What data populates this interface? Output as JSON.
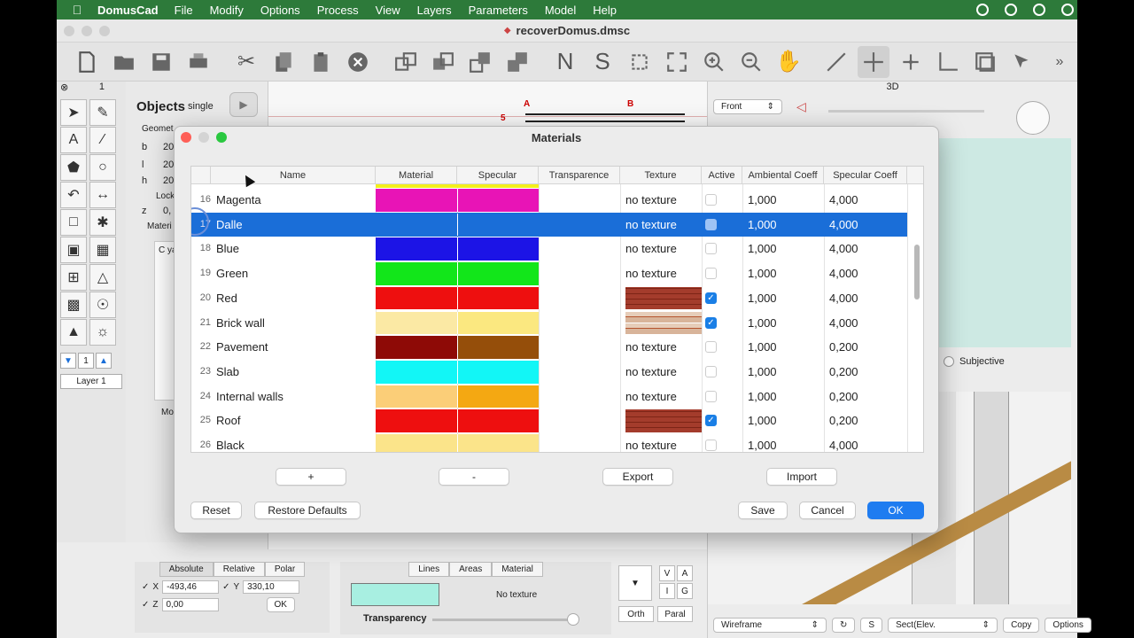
{
  "menubar": {
    "app_name": "DomusCad",
    "items": [
      "File",
      "Modify",
      "Options",
      "Process",
      "View",
      "Layers",
      "Parameters",
      "Model",
      "Help"
    ]
  },
  "window": {
    "title": "recoverDomus.dmsc"
  },
  "toolbar": {
    "icons": [
      "new-file-icon",
      "open-folder-icon",
      "save-icon",
      "print-icon",
      "cut-icon",
      "copy-icon",
      "paste-icon",
      "delete-icon",
      "layer-copy-icon",
      "layer-move-icon",
      "layer-up-icon",
      "layer-down-icon",
      "north-icon",
      "south-icon",
      "fit-icon",
      "fullscreen-icon",
      "zoom-in-icon",
      "zoom-out-icon",
      "pan-icon",
      "line-tool-icon",
      "crosshair-icon",
      "snap-icon",
      "axes-icon",
      "window-icon",
      "select-icon",
      "more-icon"
    ]
  },
  "tools_panel": {
    "page_number": "1",
    "layer_number": "1",
    "layer_name": "Layer 1"
  },
  "objects_panel": {
    "title": "Objects",
    "mode": "single",
    "geometry_label": "Geomet",
    "b": "b",
    "l": "l",
    "h": "h",
    "z": "z",
    "value_20": "20",
    "z_value": "0,",
    "lock": "Lock",
    "material": "Materi",
    "c": "C ya",
    "mo": "Mo"
  },
  "drawing": {
    "axis_a": "A",
    "axis_b": "B",
    "row_5": "5"
  },
  "pane3d": {
    "title": "3D",
    "view_select": "Front",
    "subjective": "Subjective",
    "wireframe": "Wireframe",
    "s": "S",
    "sect": "Sect(Elev.",
    "copy": "Copy",
    "options": "Options"
  },
  "coords": {
    "tabs": [
      "Absolute",
      "Relative",
      "Polar"
    ],
    "x_label": "X",
    "x_value": "-493,46",
    "y_label": "Y",
    "y_value": "330,10",
    "z_label": "Z",
    "z_value": "0,00",
    "ok": "OK"
  },
  "props": {
    "tabs": [
      "Lines",
      "Areas",
      "Material"
    ],
    "texture": "No texture",
    "transparency": "Transparency",
    "swatch_color": "#a8efe1"
  },
  "lineset": {
    "v": "V",
    "a": "A",
    "i": "I",
    "g": "G",
    "orth": "Orth",
    "paral": "Paral"
  },
  "dialog": {
    "title": "Materials",
    "columns": [
      "Name",
      "Material",
      "Specular",
      "Transparence",
      "Texture",
      "Active",
      "Ambiental Coeff",
      "Specular Coeff"
    ],
    "rows": [
      {
        "num": "16",
        "name": "Magenta",
        "material": "#e814b6",
        "specular": "#e814b6",
        "texture": "no texture",
        "active": false,
        "amb": "1,000",
        "spec": "4,000"
      },
      {
        "num": "17",
        "name": "Dalle",
        "material": "#1a6ed8",
        "specular": "#1a6ed8",
        "texture": "no texture",
        "active": false,
        "amb": "1,000",
        "spec": "4,000",
        "selected": true
      },
      {
        "num": "18",
        "name": "Blue",
        "material": "#1c14e6",
        "specular": "#1c14e6",
        "texture": "no texture",
        "active": false,
        "amb": "1,000",
        "spec": "4,000"
      },
      {
        "num": "19",
        "name": "Green",
        "material": "#12e61a",
        "specular": "#12e61a",
        "texture": "no texture",
        "active": false,
        "amb": "1,000",
        "spec": "4,000"
      },
      {
        "num": "20",
        "name": "Red",
        "material": "#ee0f0f",
        "specular": "#ee0f0f",
        "texture": "roof-tile",
        "active": true,
        "amb": "1,000",
        "spec": "4,000"
      },
      {
        "num": "21",
        "name": "Brick wall",
        "material": "#fbe9a4",
        "specular": "#fbe880",
        "texture": "brick",
        "active": true,
        "amb": "1,000",
        "spec": "4,000"
      },
      {
        "num": "22",
        "name": "Pavement",
        "material": "#8e0a06",
        "specular": "#954e0a",
        "texture": "no texture",
        "active": false,
        "amb": "1,000",
        "spec": "0,200"
      },
      {
        "num": "23",
        "name": "Slab",
        "material": "#12f6f6",
        "specular": "#12f6f6",
        "texture": "no texture",
        "active": false,
        "amb": "1,000",
        "spec": "0,200"
      },
      {
        "num": "24",
        "name": "Internal walls",
        "material": "#fbce78",
        "specular": "#f4a812",
        "texture": "no texture",
        "active": false,
        "amb": "1,000",
        "spec": "0,200"
      },
      {
        "num": "25",
        "name": "Roof",
        "material": "#ee0f0f",
        "specular": "#ee0f0f",
        "texture": "roof-tile",
        "active": true,
        "amb": "1,000",
        "spec": "0,200"
      },
      {
        "num": "26",
        "name": "Black",
        "material": "#fbe48a",
        "specular": "#fbe48a",
        "texture": "no texture",
        "active": false,
        "amb": "1,000",
        "spec": "4,000"
      }
    ],
    "buttons": {
      "plus": "+",
      "minus": "-",
      "export": "Export",
      "import": "Import",
      "reset": "Reset",
      "restore": "Restore Defaults",
      "save": "Save",
      "cancel": "Cancel",
      "ok": "OK"
    }
  }
}
